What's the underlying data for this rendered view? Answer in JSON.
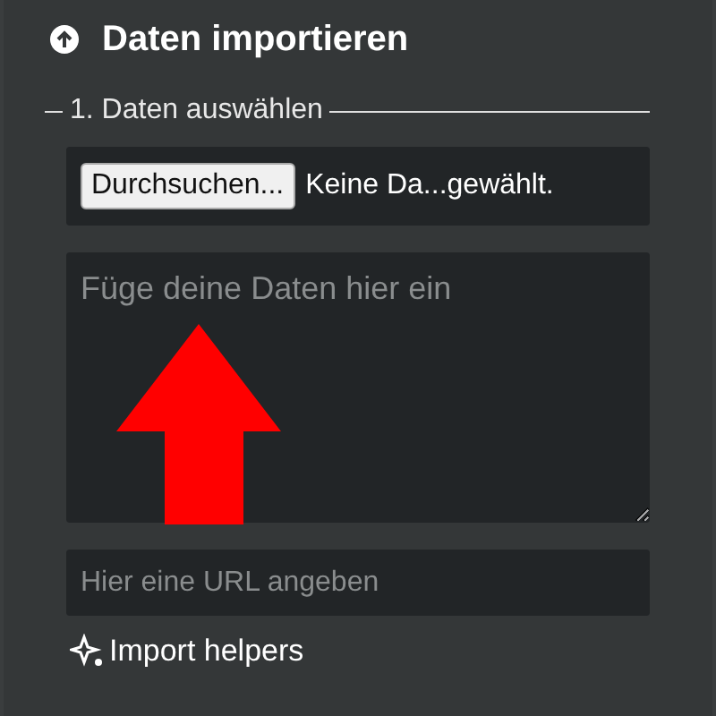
{
  "panel": {
    "title": "Daten importieren"
  },
  "fieldset": {
    "legend": "1. Daten auswählen"
  },
  "file_input": {
    "button": "Durchsuchen...",
    "status": "Keine Da...gewählt."
  },
  "paste_area": {
    "placeholder": "Füge deine Daten hier ein"
  },
  "url_field": {
    "placeholder": "Hier eine URL angeben"
  },
  "helpers_link": {
    "label": "Import helpers"
  }
}
